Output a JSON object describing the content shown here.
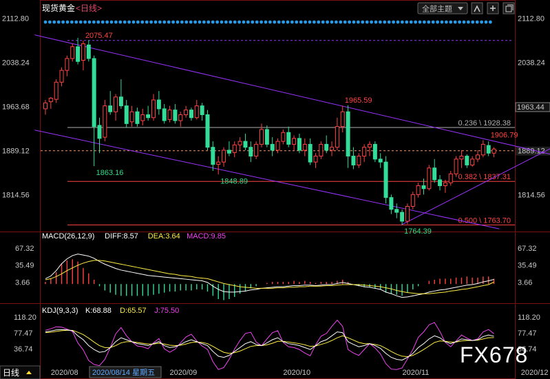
{
  "header": {
    "title": "现货黄金",
    "period_link": "<日线>",
    "theme_button": "全部主题",
    "colors": {
      "title": "#ffffff",
      "period_link": "#e0486a"
    }
  },
  "watermark": "FX678",
  "bottom_bar": {
    "tab_label": "日线",
    "tooltip_date": "2020/08/14 星期五"
  },
  "chart_data": [
    {
      "type": "candlestick",
      "name": "main",
      "yaxis_ticks": [
        1814.56,
        1889.12,
        1963.68,
        2038.24,
        2112.8
      ],
      "ylim": [
        1756,
        2116
      ],
      "current_price": 1889.12,
      "last_price_tag": "1963.44",
      "xaxis_ticks": [
        {
          "label": "2020/08",
          "index": 2
        },
        {
          "label": "2020/09",
          "index": 24
        },
        {
          "label": "2020/10",
          "index": 45
        },
        {
          "label": "2020/11",
          "index": 67
        },
        {
          "label": "2020/12",
          "index": 89
        }
      ],
      "candles": [
        [
          1960,
          1975,
          1950,
          1970
        ],
        [
          1972,
          1980,
          1960,
          1978
        ],
        [
          1976,
          2010,
          1970,
          2005
        ],
        [
          2005,
          2030,
          1998,
          2025
        ],
        [
          2025,
          2050,
          2015,
          2045
        ],
        [
          2045,
          2070,
          2040,
          2065
        ],
        [
          2065,
          2080,
          2035,
          2040
        ],
        [
          2042,
          2075,
          2025,
          2070
        ],
        [
          2068,
          2076,
          2040,
          2045
        ],
        [
          2045,
          2050,
          1863,
          1930
        ],
        [
          1932,
          1945,
          1885,
          1910
        ],
        [
          1912,
          1975,
          1905,
          1965
        ],
        [
          1965,
          1990,
          1950,
          1955
        ],
        [
          1955,
          1985,
          1940,
          1980
        ],
        [
          1980,
          2010,
          1960,
          1965
        ],
        [
          1965,
          1975,
          1928,
          1935
        ],
        [
          1938,
          1965,
          1930,
          1955
        ],
        [
          1955,
          1962,
          1930,
          1935
        ],
        [
          1940,
          1960,
          1932,
          1950
        ],
        [
          1950,
          1965,
          1940,
          1945
        ],
        [
          1945,
          1985,
          1940,
          1975
        ],
        [
          1975,
          1990,
          1950,
          1960
        ],
        [
          1960,
          1968,
          1935,
          1940
        ],
        [
          1942,
          1965,
          1937,
          1958
        ],
        [
          1958,
          1968,
          1935,
          1940
        ],
        [
          1940,
          1955,
          1930,
          1950
        ],
        [
          1950,
          1965,
          1945,
          1958
        ],
        [
          1958,
          1962,
          1940,
          1945
        ],
        [
          1945,
          1975,
          1942,
          1965
        ],
        [
          1965,
          1970,
          1940,
          1950
        ],
        [
          1950,
          1958,
          1890,
          1895
        ],
        [
          1895,
          1905,
          1855,
          1866
        ],
        [
          1866,
          1880,
          1849,
          1870
        ],
        [
          1870,
          1895,
          1862,
          1890
        ],
        [
          1890,
          1905,
          1880,
          1885
        ],
        [
          1886,
          1905,
          1878,
          1899
        ],
        [
          1899,
          1912,
          1890,
          1905
        ],
        [
          1905,
          1918,
          1890,
          1895
        ],
        [
          1895,
          1905,
          1870,
          1880
        ],
        [
          1880,
          1905,
          1875,
          1900
        ],
        [
          1900,
          1935,
          1895,
          1925
        ],
        [
          1925,
          1932,
          1895,
          1900
        ],
        [
          1900,
          1912,
          1880,
          1890
        ],
        [
          1890,
          1910,
          1885,
          1905
        ],
        [
          1905,
          1925,
          1900,
          1920
        ],
        [
          1920,
          1930,
          1895,
          1900
        ],
        [
          1900,
          1915,
          1890,
          1910
        ],
        [
          1910,
          1918,
          1885,
          1890
        ],
        [
          1890,
          1910,
          1880,
          1900
        ],
        [
          1900,
          1910,
          1865,
          1870
        ],
        [
          1870,
          1885,
          1860,
          1880
        ],
        [
          1880,
          1905,
          1875,
          1900
        ],
        [
          1900,
          1915,
          1885,
          1890
        ],
        [
          1890,
          1905,
          1880,
          1895
        ],
        [
          1895,
          1945,
          1890,
          1930
        ],
        [
          1930,
          1965,
          1920,
          1955
        ],
        [
          1955,
          1966,
          1860,
          1880
        ],
        [
          1880,
          1895,
          1858,
          1865
        ],
        [
          1865,
          1885,
          1860,
          1880
        ],
        [
          1880,
          1900,
          1870,
          1895
        ],
        [
          1895,
          1905,
          1880,
          1900
        ],
        [
          1900,
          1905,
          1870,
          1875
        ],
        [
          1875,
          1885,
          1860,
          1870
        ],
        [
          1870,
          1880,
          1800,
          1810
        ],
        [
          1810,
          1815,
          1782,
          1790
        ],
        [
          1790,
          1800,
          1775,
          1785
        ],
        [
          1785,
          1790,
          1764,
          1770
        ],
        [
          1770,
          1800,
          1765,
          1795
        ],
        [
          1795,
          1820,
          1790,
          1815
        ],
        [
          1815,
          1835,
          1810,
          1830
        ],
        [
          1830,
          1842,
          1815,
          1825
        ],
        [
          1825,
          1865,
          1822,
          1860
        ],
        [
          1860,
          1875,
          1835,
          1840
        ],
        [
          1840,
          1848,
          1822,
          1830
        ],
        [
          1830,
          1840,
          1818,
          1835
        ],
        [
          1835,
          1855,
          1830,
          1850
        ],
        [
          1850,
          1880,
          1845,
          1875
        ],
        [
          1875,
          1890,
          1860,
          1880
        ],
        [
          1880,
          1883,
          1860,
          1865
        ],
        [
          1865,
          1880,
          1862,
          1875
        ],
        [
          1875,
          1890,
          1870,
          1882
        ],
        [
          1882,
          1907,
          1878,
          1900
        ],
        [
          1898,
          1905,
          1880,
          1885
        ],
        [
          1885,
          1895,
          1878,
          1892
        ]
      ],
      "annotations": [
        {
          "text": "2075.47",
          "at": [
            7,
            2075.47
          ],
          "color": "#ff4444"
        },
        {
          "text": "1863.16",
          "at": [
            9,
            1863.16
          ],
          "color": "#33dd88"
        },
        {
          "text": "1848.89",
          "at": [
            32,
            1848.89
          ],
          "color": "#33dd88"
        },
        {
          "text": "1965.59",
          "at": [
            55,
            1965.59
          ],
          "color": "#ff4444"
        },
        {
          "text": "1764.39",
          "at": [
            66,
            1764.39
          ],
          "color": "#33dd88"
        },
        {
          "text": "1906.79",
          "at": [
            82,
            1906.79
          ],
          "color": "#ff4444"
        }
      ],
      "fib_levels": [
        {
          "label": "0.236 \\ 1928.38",
          "value": 1928.38,
          "color": "#b0b0b0"
        },
        {
          "label": "0.382 \\ 1837.31",
          "value": 1837.31,
          "color": "#ff4444"
        },
        {
          "label": "0.500 \\ 1763.70",
          "value": 1763.7,
          "color": "#ff4444"
        }
      ],
      "top_dotted_level": 2075.47,
      "channel_lines": [
        {
          "from": [
            -2,
            2085
          ],
          "to": [
            95,
            1880
          ]
        },
        {
          "from": [
            -2,
            1924
          ],
          "to": [
            84,
            1757
          ]
        },
        {
          "from": [
            66,
            1764.39
          ],
          "to": [
            95,
            1900
          ]
        }
      ],
      "grid": false,
      "colors": {
        "up": "#ff4444",
        "down": "#33dd99",
        "channel": "#9933ff"
      }
    },
    {
      "type": "bar+line",
      "name": "MACD",
      "title": "MACD(26,12,9)",
      "readouts": [
        {
          "text": "DIFF:8.57",
          "color": "#ffffff"
        },
        {
          "text": "DEA:3.64",
          "color": "#ffee44"
        },
        {
          "text": "MACD:9.85",
          "color": "#ee44ee"
        }
      ],
      "yaxis_ticks": [
        3.66,
        35.49,
        67.32
      ],
      "ylim": [
        -28,
        85
      ],
      "series": [
        {
          "name": "DIFF",
          "values": [
            10,
            15,
            25,
            38,
            47,
            53,
            56,
            54,
            52,
            48,
            42,
            37,
            33,
            29,
            26,
            24,
            22,
            20,
            18,
            16,
            15,
            14,
            13,
            12,
            11,
            10,
            9,
            8,
            7,
            6,
            3,
            -4,
            -10,
            -14,
            -15,
            -15,
            -14,
            -13,
            -11,
            -10,
            -8,
            -7,
            -6,
            -5,
            -5,
            -4,
            -3,
            -3,
            -2,
            -2,
            -3,
            -2,
            -1,
            -1,
            1,
            3,
            1,
            -1,
            -3,
            -5,
            -6,
            -8,
            -10,
            -15,
            -18,
            -22,
            -25,
            -24,
            -22,
            -20,
            -18,
            -15,
            -13,
            -11,
            -10,
            -8,
            -6,
            -4,
            -2,
            -1,
            1,
            4,
            6,
            8.57
          ],
          "color": "#ffffff"
        },
        {
          "name": "DEA",
          "values": [
            8,
            10,
            14,
            19,
            25,
            30,
            35,
            39,
            42,
            44,
            44,
            43,
            41,
            39,
            37,
            35,
            33,
            31,
            29,
            27,
            25,
            23,
            21,
            19,
            18,
            16,
            15,
            14,
            12,
            11,
            10,
            7,
            4,
            1,
            -1,
            -3,
            -5,
            -6,
            -7,
            -8,
            -8,
            -8,
            -8,
            -7,
            -7,
            -6,
            -6,
            -5,
            -5,
            -4,
            -4,
            -4,
            -3,
            -3,
            -2,
            -1,
            -1,
            -1,
            -1,
            -2,
            -3,
            -4,
            -5,
            -7,
            -9,
            -12,
            -14,
            -16,
            -17,
            -18,
            -18,
            -18,
            -17,
            -16,
            -15,
            -13,
            -12,
            -10,
            -9,
            -7,
            -5,
            -3,
            -1,
            3.64
          ],
          "color": "#ffee44"
        },
        {
          "name": "MACD",
          "values": [
            4,
            10,
            22,
            38,
            44,
            46,
            42,
            30,
            20,
            8,
            -4,
            -12,
            -16,
            -20,
            -22,
            -22,
            -22,
            -22,
            -22,
            -22,
            -20,
            -18,
            -16,
            -14,
            -14,
            -12,
            -12,
            -12,
            -10,
            -10,
            -14,
            -22,
            -28,
            -30,
            -28,
            -24,
            -18,
            -14,
            -8,
            -4,
            0,
            2,
            4,
            4,
            4,
            4,
            6,
            4,
            6,
            4,
            2,
            4,
            4,
            4,
            6,
            8,
            4,
            0,
            -4,
            -6,
            -6,
            -8,
            -10,
            -16,
            -18,
            -20,
            -22,
            -16,
            -10,
            -4,
            0,
            6,
            8,
            10,
            10,
            10,
            12,
            12,
            14,
            12,
            12,
            14,
            14,
            9.85
          ]
        }
      ]
    },
    {
      "type": "line",
      "name": "KDJ",
      "title": "KDJ(9,3,3)",
      "readouts": [
        {
          "text": "K:68.88",
          "color": "#ffffff"
        },
        {
          "text": "D:65.57",
          "color": "#ffee44"
        },
        {
          "text": "J:75.50",
          "color": "#ee44ee"
        }
      ],
      "yaxis_ticks": [
        36.74,
        77.47,
        118.2
      ],
      "ylim": [
        -5,
        125
      ],
      "series": [
        {
          "name": "K",
          "values": [
            80,
            82,
            85,
            86,
            85,
            83,
            70,
            60,
            45,
            35,
            28,
            30,
            40,
            55,
            65,
            60,
            55,
            50,
            48,
            45,
            50,
            55,
            45,
            40,
            42,
            48,
            55,
            60,
            55,
            50,
            45,
            30,
            18,
            15,
            20,
            30,
            40,
            50,
            55,
            48,
            45,
            52,
            60,
            65,
            55,
            50,
            48,
            45,
            40,
            35,
            45,
            55,
            60,
            70,
            80,
            78,
            55,
            48,
            42,
            45,
            50,
            45,
            38,
            25,
            15,
            10,
            8,
            15,
            25,
            40,
            50,
            62,
            70,
            65,
            55,
            50,
            55,
            62,
            60,
            58,
            60,
            68,
            72,
            68.88
          ],
          "color": "#ffffff"
        },
        {
          "name": "D",
          "values": [
            78,
            79,
            81,
            83,
            84,
            84,
            79,
            73,
            64,
            54,
            45,
            40,
            40,
            45,
            52,
            55,
            55,
            53,
            51,
            49,
            49,
            51,
            49,
            46,
            45,
            46,
            49,
            53,
            54,
            53,
            50,
            43,
            35,
            28,
            25,
            27,
            31,
            37,
            43,
            45,
            45,
            47,
            51,
            56,
            56,
            54,
            52,
            50,
            47,
            43,
            44,
            48,
            52,
            58,
            65,
            70,
            65,
            59,
            53,
            50,
            50,
            48,
            45,
            38,
            30,
            23,
            18,
            17,
            20,
            27,
            35,
            44,
            53,
            57,
            56,
            54,
            54,
            57,
            58,
            58,
            59,
            62,
            65,
            65.57
          ],
          "color": "#ffee44"
        },
        {
          "name": "J",
          "values": [
            84,
            88,
            93,
            92,
            87,
            81,
            52,
            34,
            7,
            -3,
            -6,
            10,
            40,
            75,
            91,
            70,
            55,
            44,
            42,
            37,
            52,
            63,
            37,
            28,
            36,
            52,
            67,
            74,
            57,
            44,
            35,
            4,
            -16,
            -11,
            10,
            36,
            58,
            76,
            79,
            54,
            45,
            62,
            78,
            83,
            53,
            42,
            40,
            35,
            26,
            19,
            47,
            69,
            76,
            94,
            110,
            94,
            35,
            26,
            20,
            35,
            50,
            39,
            24,
            -1,
            -15,
            -16,
            -12,
            11,
            35,
            66,
            80,
            98,
            104,
            81,
            53,
            42,
            57,
            72,
            64,
            58,
            62,
            80,
            86,
            75.5
          ],
          "color": "#ee44ee"
        }
      ]
    }
  ]
}
